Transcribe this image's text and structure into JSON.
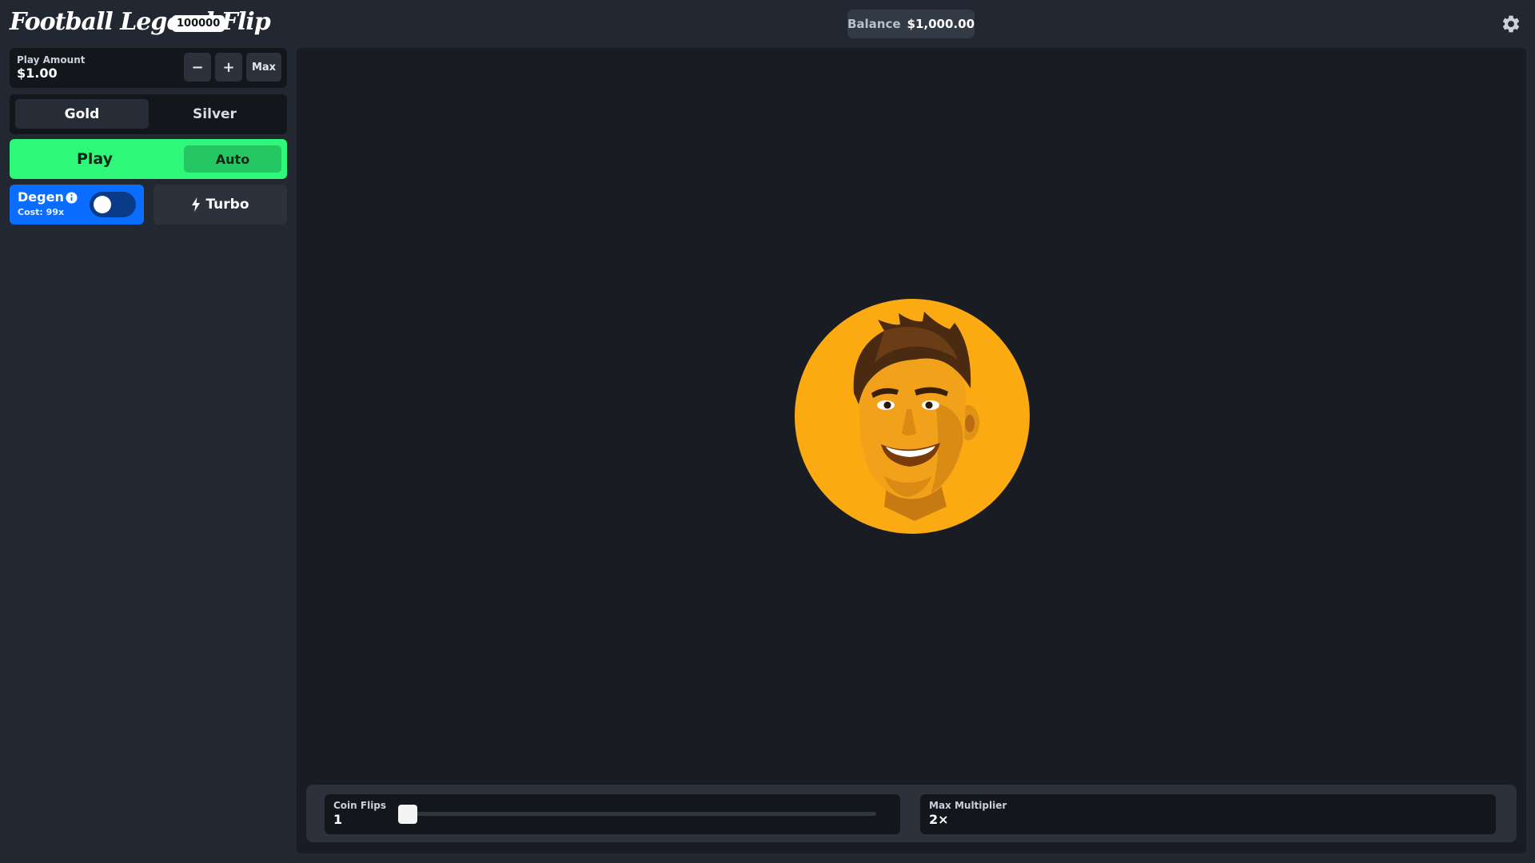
{
  "header": {
    "logo_text": "Football Legend Flip",
    "logo_badge": "100000",
    "balance_label": "Balance",
    "balance_value": "$1,000.00",
    "settings_icon": "gear-icon"
  },
  "sidebar": {
    "play_amount_label": "Play Amount",
    "play_amount_value": "$1.00",
    "minus_label": "−",
    "plus_label": "+",
    "max_label": "Max",
    "coin_options": [
      "Gold",
      "Silver"
    ],
    "selected_coin": "Gold",
    "play_label": "Play",
    "auto_label": "Auto",
    "degen_label": "Degen",
    "degen_cost": "Cost: 99x",
    "degen_enabled": false,
    "turbo_label": "Turbo"
  },
  "stage": {
    "coin_face": "football-player-portrait",
    "coin_flips_label": "Coin Flips",
    "coin_flips_value": "1",
    "coin_flips_slider_fraction": 0,
    "max_multiplier_label": "Max Multiplier",
    "max_multiplier_value": "2×"
  },
  "colors": {
    "background": "#222831",
    "stage": "#191c22",
    "play_green": "#2ff77a",
    "auto_green": "#24c762",
    "degen_blue": "#0b6dff",
    "coin_gold": "#fcaa11"
  }
}
